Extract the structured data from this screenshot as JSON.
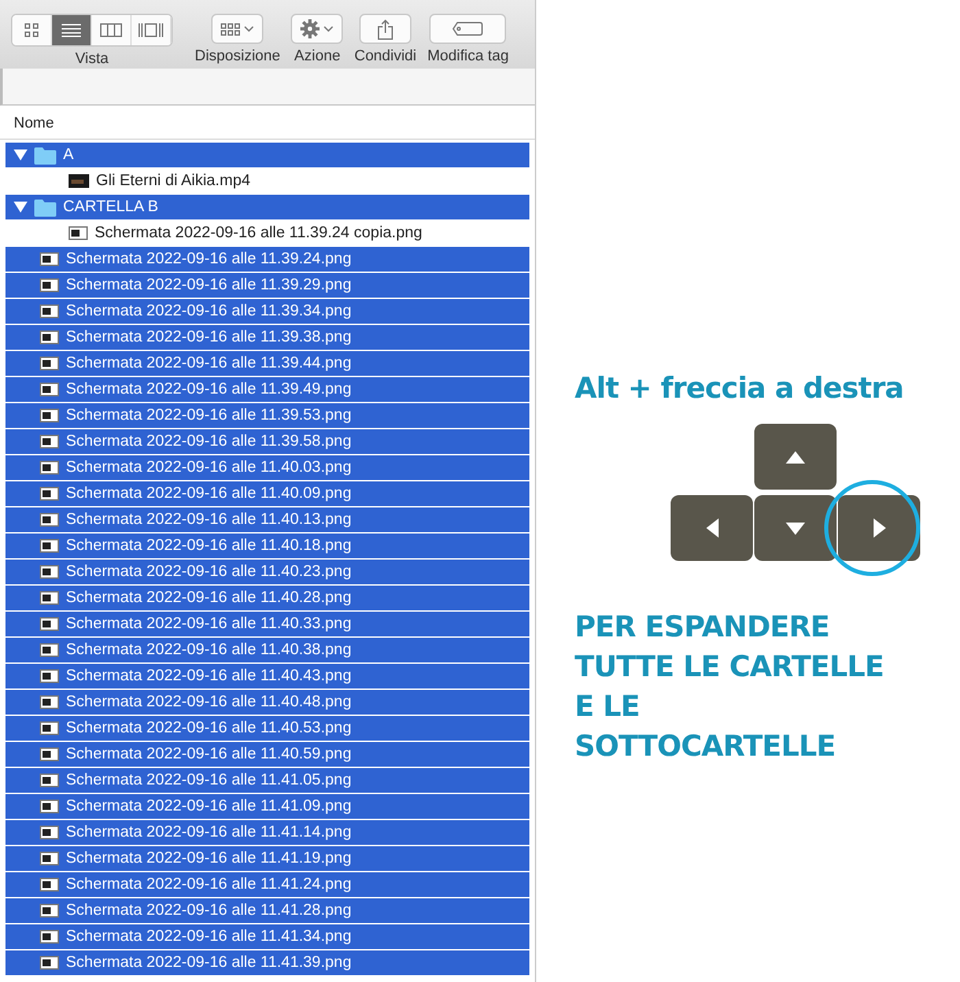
{
  "toolbar": {
    "view_modes": [
      {
        "kind": "icons",
        "selected": false
      },
      {
        "kind": "list",
        "selected": true
      },
      {
        "kind": "columns",
        "selected": false
      },
      {
        "kind": "gallery",
        "selected": false
      }
    ],
    "view_label": "Vista",
    "buttons": [
      {
        "kind": "arrange",
        "label": "Disposizione"
      },
      {
        "kind": "action",
        "label": "Azione"
      },
      {
        "kind": "share",
        "label": "Condividi"
      },
      {
        "kind": "tag",
        "label": "Modifica tag"
      }
    ]
  },
  "file_list": {
    "column": "Nome",
    "items": [
      {
        "kind": "folder",
        "name": "A",
        "selected": true,
        "expanded": true,
        "children": [
          {
            "kind": "video",
            "name": "Gli Eterni di Aikia.mp4",
            "selected": false
          }
        ]
      },
      {
        "kind": "folder",
        "name": "CARTELLA B",
        "selected": true,
        "expanded": true,
        "children": [
          {
            "kind": "image",
            "name": "Schermata 2022-09-16 alle 11.39.24 copia.png",
            "selected": false
          }
        ]
      },
      {
        "kind": "image",
        "name": "Schermata 2022-09-16 alle 11.39.24.png",
        "selected": true
      },
      {
        "kind": "image",
        "name": "Schermata 2022-09-16 alle 11.39.29.png",
        "selected": true
      },
      {
        "kind": "image",
        "name": "Schermata 2022-09-16 alle 11.39.34.png",
        "selected": true
      },
      {
        "kind": "image",
        "name": "Schermata 2022-09-16 alle 11.39.38.png",
        "selected": true
      },
      {
        "kind": "image",
        "name": "Schermata 2022-09-16 alle 11.39.44.png",
        "selected": true
      },
      {
        "kind": "image",
        "name": "Schermata 2022-09-16 alle 11.39.49.png",
        "selected": true
      },
      {
        "kind": "image",
        "name": "Schermata 2022-09-16 alle 11.39.53.png",
        "selected": true
      },
      {
        "kind": "image",
        "name": "Schermata 2022-09-16 alle 11.39.58.png",
        "selected": true
      },
      {
        "kind": "image",
        "name": "Schermata 2022-09-16 alle 11.40.03.png",
        "selected": true
      },
      {
        "kind": "image",
        "name": "Schermata 2022-09-16 alle 11.40.09.png",
        "selected": true
      },
      {
        "kind": "image",
        "name": "Schermata 2022-09-16 alle 11.40.13.png",
        "selected": true
      },
      {
        "kind": "image",
        "name": "Schermata 2022-09-16 alle 11.40.18.png",
        "selected": true
      },
      {
        "kind": "image",
        "name": "Schermata 2022-09-16 alle 11.40.23.png",
        "selected": true
      },
      {
        "kind": "image",
        "name": "Schermata 2022-09-16 alle 11.40.28.png",
        "selected": true
      },
      {
        "kind": "image",
        "name": "Schermata 2022-09-16 alle 11.40.33.png",
        "selected": true
      },
      {
        "kind": "image",
        "name": "Schermata 2022-09-16 alle 11.40.38.png",
        "selected": true
      },
      {
        "kind": "image",
        "name": "Schermata 2022-09-16 alle 11.40.43.png",
        "selected": true
      },
      {
        "kind": "image",
        "name": "Schermata 2022-09-16 alle 11.40.48.png",
        "selected": true
      },
      {
        "kind": "image",
        "name": "Schermata 2022-09-16 alle 11.40.53.png",
        "selected": true
      },
      {
        "kind": "image",
        "name": "Schermata 2022-09-16 alle 11.40.59.png",
        "selected": true
      },
      {
        "kind": "image",
        "name": "Schermata 2022-09-16 alle 11.41.05.png",
        "selected": true
      },
      {
        "kind": "image",
        "name": "Schermata 2022-09-16 alle 11.41.09.png",
        "selected": true
      },
      {
        "kind": "image",
        "name": "Schermata 2022-09-16 alle 11.41.14.png",
        "selected": true
      },
      {
        "kind": "image",
        "name": "Schermata 2022-09-16 alle 11.41.19.png",
        "selected": true
      },
      {
        "kind": "image",
        "name": "Schermata 2022-09-16 alle 11.41.24.png",
        "selected": true
      },
      {
        "kind": "image",
        "name": "Schermata 2022-09-16 alle 11.41.28.png",
        "selected": true
      },
      {
        "kind": "image",
        "name": "Schermata 2022-09-16 alle 11.41.34.png",
        "selected": true
      },
      {
        "kind": "image",
        "name": "Schermata 2022-09-16 alle 11.41.39.png",
        "selected": true
      }
    ]
  },
  "hint": {
    "title": "Alt + freccia a destra",
    "keys": [
      {
        "kind": "up",
        "highlighted": false
      },
      {
        "kind": "left",
        "highlighted": false
      },
      {
        "kind": "down",
        "highlighted": false
      },
      {
        "kind": "right",
        "highlighted": true
      }
    ],
    "caption": [
      "PER ESPANDERE",
      "TUTTE LE CARTELLE",
      "E LE",
      "SOTTOCARTELLE"
    ]
  }
}
